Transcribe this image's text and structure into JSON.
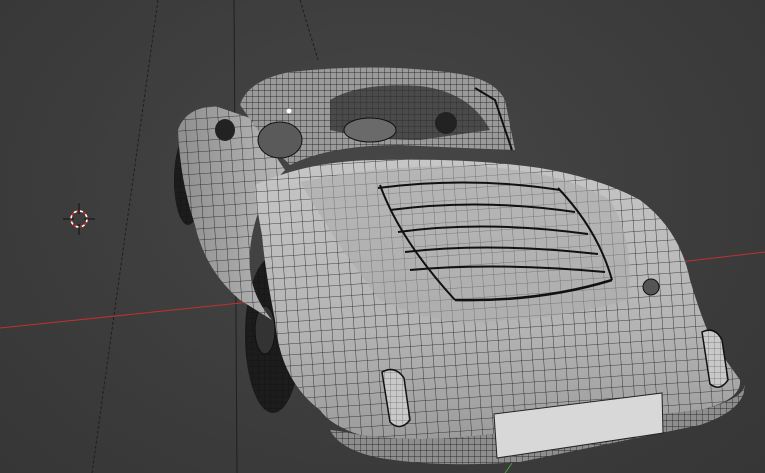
{
  "viewport": {
    "background_color": "#3d3d3d",
    "grid_line_color": "#1f1f1f",
    "x_axis_color": "#c03030",
    "y_axis_color": "#40a040",
    "wire_color": "#1a1a1a",
    "body_color": "#b9b9b9",
    "shade_color": "#8a8a8a",
    "plate_color": "#d8d8d8"
  },
  "icons": {
    "cursor": "3d-cursor-icon",
    "light": "light-object-icon"
  }
}
